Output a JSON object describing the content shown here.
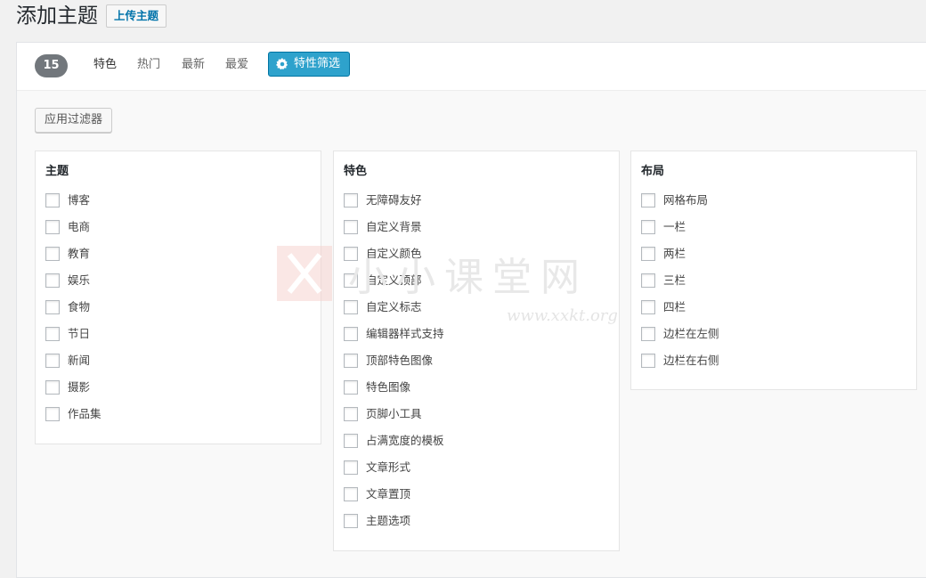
{
  "header": {
    "title": "添加主题",
    "upload_label": "上传主题"
  },
  "filter_bar": {
    "count": "15",
    "tabs": [
      {
        "label": "特色"
      },
      {
        "label": "热门"
      },
      {
        "label": "最新"
      },
      {
        "label": "最爱"
      }
    ],
    "feature_filter_label": "特性筛选"
  },
  "apply_filter_label": "应用过滤器",
  "groups": [
    {
      "heading": "主题",
      "items": [
        "博客",
        "电商",
        "教育",
        "娱乐",
        "食物",
        "节日",
        "新闻",
        "摄影",
        "作品集"
      ]
    },
    {
      "heading": "特色",
      "items": [
        "无障碍友好",
        "自定义背景",
        "自定义颜色",
        "自定义顶部",
        "自定义标志",
        "编辑器样式支持",
        "顶部特色图像",
        "特色图像",
        "页脚小工具",
        "占满宽度的模板",
        "文章形式",
        "文章置顶",
        "主题选项"
      ]
    },
    {
      "heading": "布局",
      "items": [
        "网格布局",
        "一栏",
        "两栏",
        "三栏",
        "四栏",
        "边栏在左侧",
        "边栏在右侧"
      ]
    }
  ],
  "watermark": {
    "text": "小小课堂网",
    "url": "www.xxkt.org"
  },
  "colors": {
    "accent": "#2ea2cc",
    "link": "#0073aa",
    "badge": "#72777c"
  }
}
